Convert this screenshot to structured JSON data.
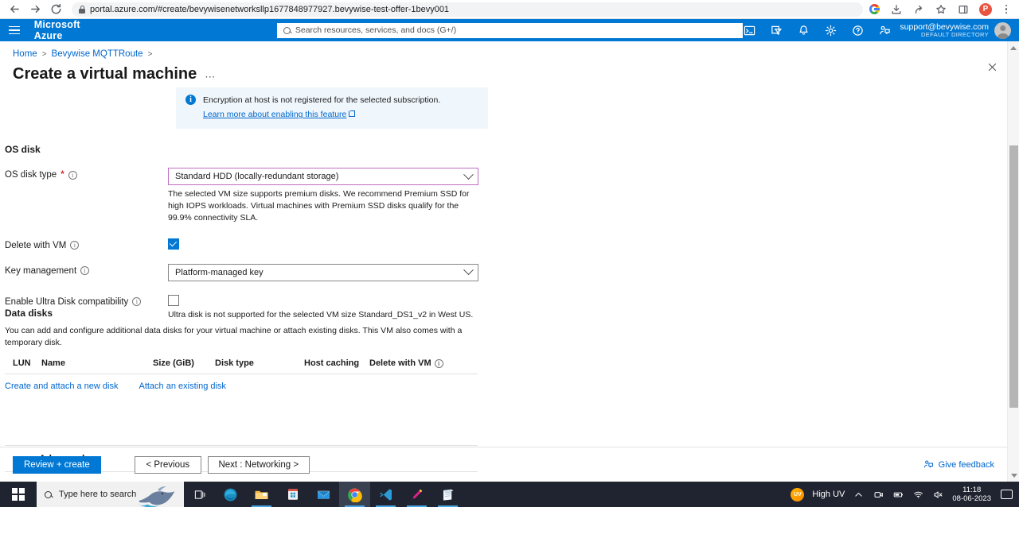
{
  "browser": {
    "url": "portal.azure.com/#create/bevywisenetworksllp1677848977927.bevywise-test-offer-1bevy001",
    "back_label": "Back",
    "forward_label": "Forward",
    "reload_label": "Reload",
    "profile_initial": "P"
  },
  "azure_header": {
    "brand": "Microsoft Azure",
    "search_placeholder": "Search resources, services, and docs (G+/)",
    "account_email": "support@bevywise.com",
    "account_directory": "DEFAULT DIRECTORY"
  },
  "blade": {
    "breadcrumb": [
      "Home",
      "Bevywise MQTTRoute"
    ],
    "title": "Create a virtual machine",
    "ellipsis": "⋯",
    "banner": {
      "message": "Encryption at host is not registered for the selected subscription.",
      "link": "Learn more about enabling this feature"
    },
    "os_disk": {
      "section_title": "OS disk",
      "disk_type_label": "OS disk type",
      "disk_type_required": "*",
      "disk_type_value": "Standard HDD (locally-redundant storage)",
      "disk_type_helper": "The selected VM size supports premium disks. We recommend Premium SSD for high IOPS workloads. Virtual machines with Premium SSD disks qualify for the 99.9% connectivity SLA.",
      "delete_with_vm_label": "Delete with VM",
      "delete_with_vm_checked": true,
      "key_management_label": "Key management",
      "key_management_value": "Platform-managed key",
      "ultra_disk_label": "Enable Ultra Disk compatibility",
      "ultra_disk_checked": false,
      "ultra_disk_helper": "Ultra disk is not supported for the selected VM size Standard_DS1_v2 in West US."
    },
    "data_disks": {
      "section_title": "Data disks",
      "description": "You can add and configure additional data disks for your virtual machine or attach existing disks. This VM also comes with a temporary disk.",
      "columns": [
        "LUN",
        "Name",
        "Size (GiB)",
        "Disk type",
        "Host caching",
        "Delete with VM"
      ],
      "rows": [],
      "create_link": "Create and attach a new disk",
      "attach_link": "Attach an existing disk"
    },
    "advanced_label": "Advanced",
    "footer": {
      "review_create": "Review + create",
      "previous": "< Previous",
      "next": "Next : Networking >",
      "feedback": "Give feedback"
    },
    "accent_color": "#0078d4",
    "focus_border_color": "#c06ec0"
  },
  "taskbar": {
    "search_placeholder": "Type here to search",
    "weather": "High UV",
    "uv_badge": "UV",
    "time": "11:18",
    "date": "08-06-2023"
  }
}
